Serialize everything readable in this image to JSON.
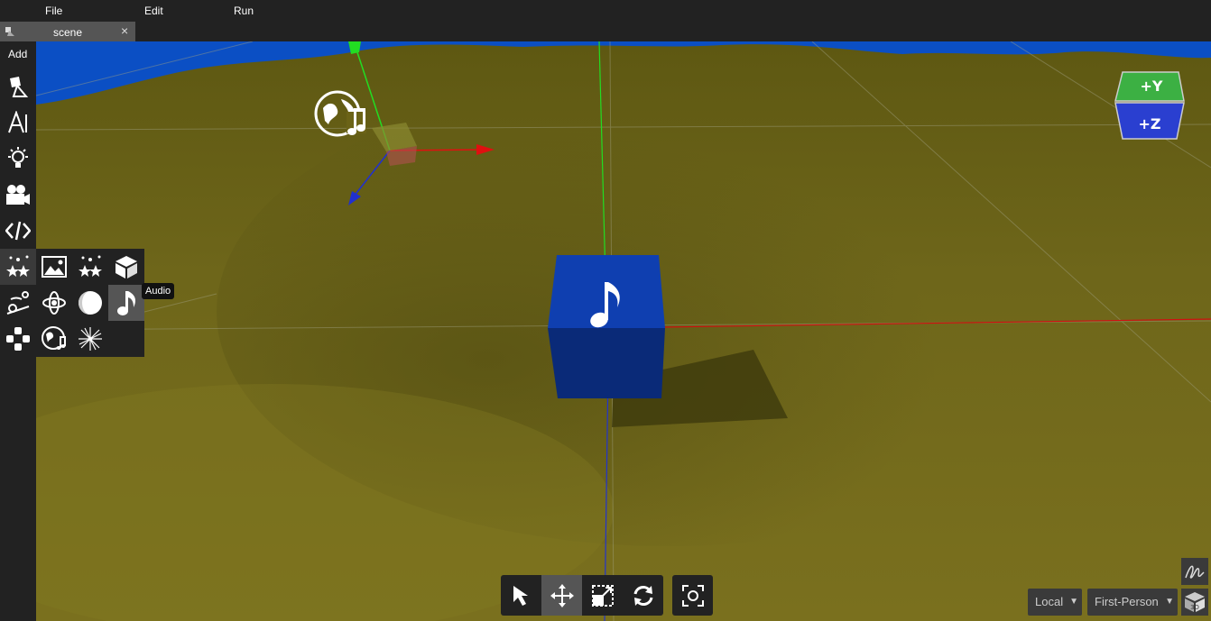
{
  "menu": {
    "file": "File",
    "edit": "Edit",
    "run": "Run"
  },
  "tab": {
    "label": "scene",
    "close": "×"
  },
  "sidebar": {
    "add_label": "Add",
    "items": [
      "object-icon",
      "text-icon",
      "light-icon",
      "camera-icon",
      "code-icon",
      "effects-icon",
      "physics-icon",
      "controls-icon"
    ]
  },
  "add_submenu": {
    "items": [
      "sky-image-icon",
      "particles-icon",
      "box-icon",
      "orbit-icon",
      "sphere-icon",
      "audio-icon",
      "positional-audio-icon",
      "lens-flare-icon"
    ],
    "tooltip": "Audio"
  },
  "orientation_cube": {
    "top": "+Y",
    "front": "+Z",
    "top_color": "#3cb043",
    "front_color": "#2a3fd0"
  },
  "bottom_toolbar": {
    "tools": [
      "select-tool",
      "move-tool",
      "scale-tool",
      "rotate-tool"
    ],
    "active": "move-tool"
  },
  "space_mode": "Local",
  "camera_mode": "First-Person",
  "colors": {
    "terrain": "#6b6317",
    "sky": "#0b4fc4",
    "cube": "#0f3fb0",
    "panel": "#222222"
  }
}
